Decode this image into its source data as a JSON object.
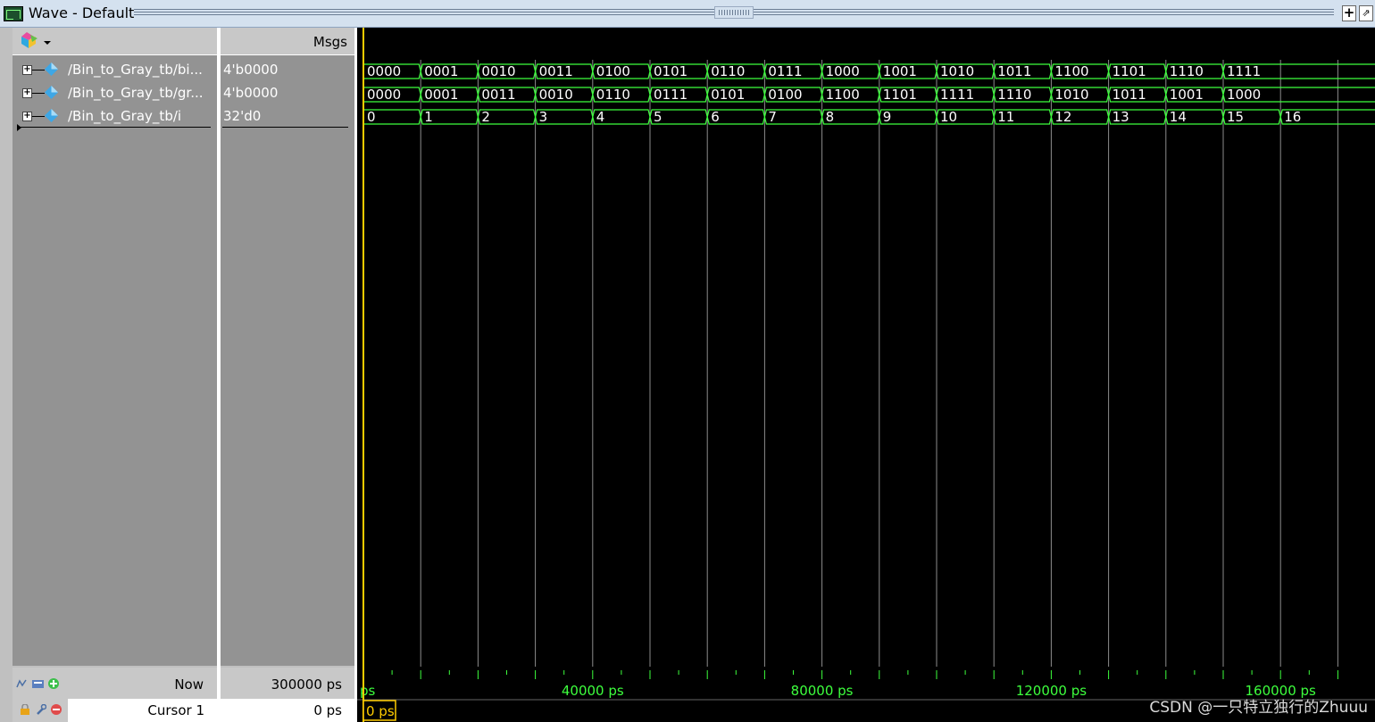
{
  "window": {
    "title": "Wave - Default",
    "add_symbol": "+",
    "undock_symbol": "⇗"
  },
  "header": {
    "msgs_label": "Msgs"
  },
  "signals": [
    {
      "name": "/Bin_to_Gray_tb/bi...",
      "value": "4'b0000"
    },
    {
      "name": "/Bin_to_Gray_tb/gr...",
      "value": "4'b0000"
    },
    {
      "name": "/Bin_to_Gray_tb/i",
      "value": "32'd0"
    }
  ],
  "waves": {
    "bin": [
      "0000",
      "0001",
      "0010",
      "0011",
      "0100",
      "0101",
      "0110",
      "0111",
      "1000",
      "1001",
      "1010",
      "1011",
      "1100",
      "1101",
      "1110",
      "1111"
    ],
    "gray": [
      "0000",
      "0001",
      "0011",
      "0010",
      "0110",
      "0111",
      "0101",
      "0100",
      "1100",
      "1101",
      "1111",
      "1110",
      "1010",
      "1011",
      "1001",
      "1000"
    ],
    "i": [
      "0",
      "1",
      "2",
      "3",
      "4",
      "5",
      "6",
      "7",
      "8",
      "9",
      "10",
      "11",
      "12",
      "13",
      "14",
      "15",
      "16"
    ]
  },
  "status": {
    "now_label": "Now",
    "now_value": "300000 ps",
    "cursor_label": "Cursor 1",
    "cursor_value": "0 ps",
    "cursor_box": "0 ps"
  },
  "timeline": {
    "start_label": "ps",
    "labels": [
      "40000 ps",
      "80000 ps",
      "120000 ps",
      "160000 ps"
    ]
  },
  "colors": {
    "wave": "#3dff3d",
    "cursor": "#ffcc00",
    "grid": "#8c8c8c",
    "text": "#ffffff"
  },
  "watermark": "CSDN @一只特立独行的Zhuuu"
}
